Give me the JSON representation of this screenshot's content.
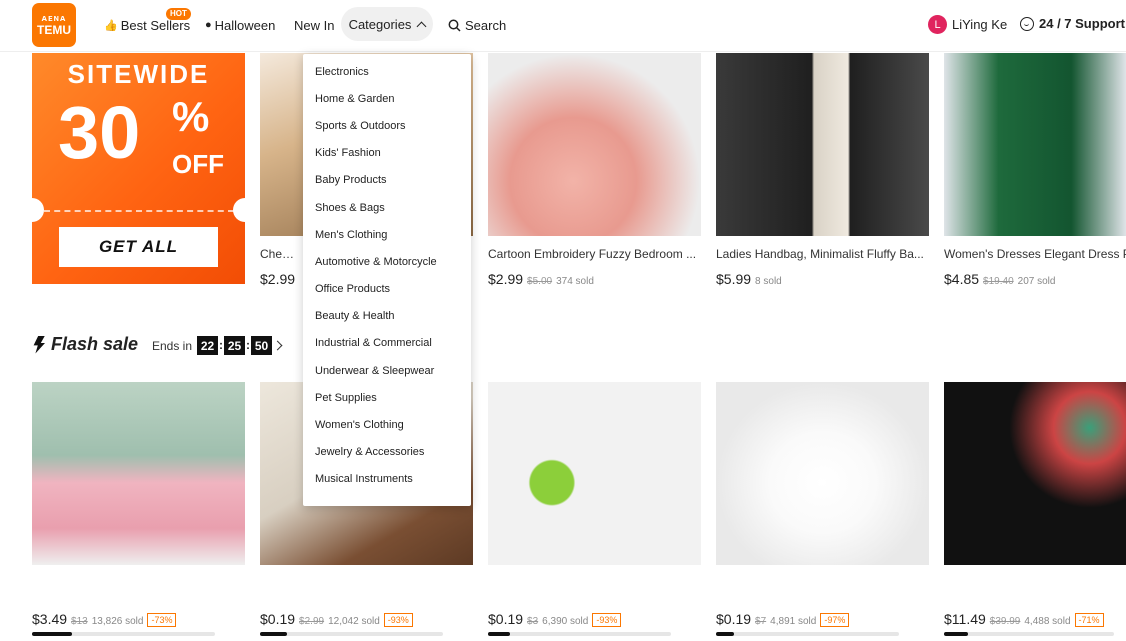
{
  "header": {
    "logo_glyphs": "ᴀᴇɴᴀ",
    "logo_text": "TEMU",
    "nav": {
      "best_sellers": "Best Sellers",
      "hot_badge": "HOT",
      "halloween": "Halloween",
      "new_in": "New In",
      "categories": "Categories",
      "search": "Search"
    },
    "user": {
      "initial": "L",
      "name": "LiYing Ke"
    },
    "support": "24 / 7 Support"
  },
  "categories_menu": [
    "Electronics",
    "Home & Garden",
    "Sports & Outdoors",
    "Kids' Fashion",
    "Baby Products",
    "Shoes & Bags",
    "Men's Clothing",
    "Automotive & Motorcycle",
    "Office Products",
    "Beauty & Health",
    "Industrial & Commercial",
    "Underwear & Sleepwear",
    "Pet Supplies",
    "Women's Clothing",
    "Jewelry & Accessories",
    "Musical Instruments"
  ],
  "promo": {
    "line1": "SITEWIDE",
    "percent": "30",
    "pct_sign": "%",
    "off": "OFF",
    "cta": "GET ALL"
  },
  "top_products": [
    {
      "title": "Cheese",
      "price": "$2.99",
      "old": "",
      "sold": ""
    },
    {
      "title": "Cartoon Embroidery Fuzzy Bedroom ...",
      "price": "$2.99",
      "old": "$5.00",
      "sold": "374 sold"
    },
    {
      "title": "Ladies Handbag, Minimalist Fluffy Ba...",
      "price": "$5.99",
      "old": "",
      "sold": "8 sold"
    },
    {
      "title": "Women's Dresses Elegant Dress Pl",
      "price": "$4.85",
      "old": "$19.40",
      "sold": "207 sold"
    }
  ],
  "flash_sale": {
    "title": "Flash sale",
    "ends_in": "Ends in",
    "hours": "22",
    "minutes": "25",
    "seconds": "50",
    "colon": ":",
    "products": [
      {
        "price": "$3.49",
        "old": "$13",
        "sold": "13,826 sold",
        "discount": "-73%",
        "progress": 0.22
      },
      {
        "price": "$0.19",
        "old": "$2.99",
        "sold": "12,042 sold",
        "discount": "-93%",
        "progress": 0.15
      },
      {
        "price": "$0.19",
        "old": "$3",
        "sold": "6,390 sold",
        "discount": "-93%",
        "progress": 0.12
      },
      {
        "price": "$0.19",
        "old": "$7",
        "sold": "4,891 sold",
        "discount": "-97%",
        "progress": 0.1
      },
      {
        "price": "$11.49",
        "old": "$39.99",
        "sold": "4,488 sold",
        "discount": "-71%",
        "progress": 0.14
      }
    ]
  },
  "colors": {
    "brand": "#fb7701",
    "avatar": "#e0245e"
  }
}
